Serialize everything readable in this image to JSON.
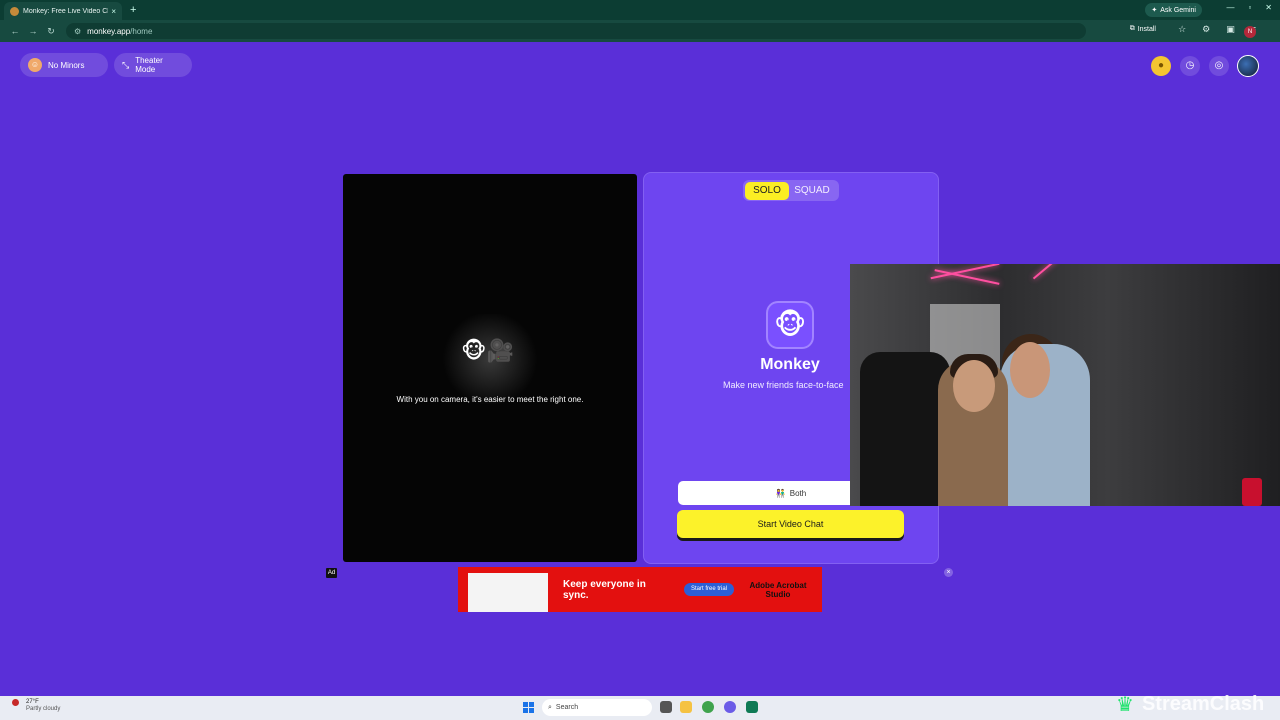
{
  "browser": {
    "tab_title": "Monkey: Free Live Video Chat",
    "new_tab_glyph": "+",
    "ask_gemini": "Ask Gemini",
    "url_host": "monkey.app",
    "url_path": "/home",
    "install_label": "Install",
    "profile_initial": "N"
  },
  "topbar": {
    "no_minors_label": "No Minors",
    "theater_mode_label": "Theater Mode",
    "icons": [
      "coin-icon",
      "history-icon",
      "chat-icon",
      "avatar"
    ]
  },
  "camera": {
    "message": "With you on camera, it's easier to meet the right one.",
    "emoji": "🐵🎥",
    "ad_tag": "Ad"
  },
  "panel": {
    "modes": [
      "SOLO",
      "SQUAD"
    ],
    "active_mode": "SOLO",
    "logo_emoji": "🐵",
    "app_name": "Monkey",
    "tagline": "Make new friends face-to-face",
    "gender_label": "Both",
    "gender_icon": "👫",
    "start_button": "Start Video Chat"
  },
  "ad": {
    "headline": "Keep everyone in sync.",
    "cta": "Start free trial",
    "brand": "Adobe Acrobat Studio",
    "close_glyph": "×"
  },
  "taskbar": {
    "temperature": "27°F",
    "condition": "Partly cloudy",
    "search_placeholder": "Search"
  },
  "watermark": "StreamClash",
  "colors": {
    "page_bg": "#5a2fd8",
    "panel_bg": "#6e45f0",
    "accent_yellow": "#fcf22a",
    "browser_chrome": "#0c3d33"
  }
}
